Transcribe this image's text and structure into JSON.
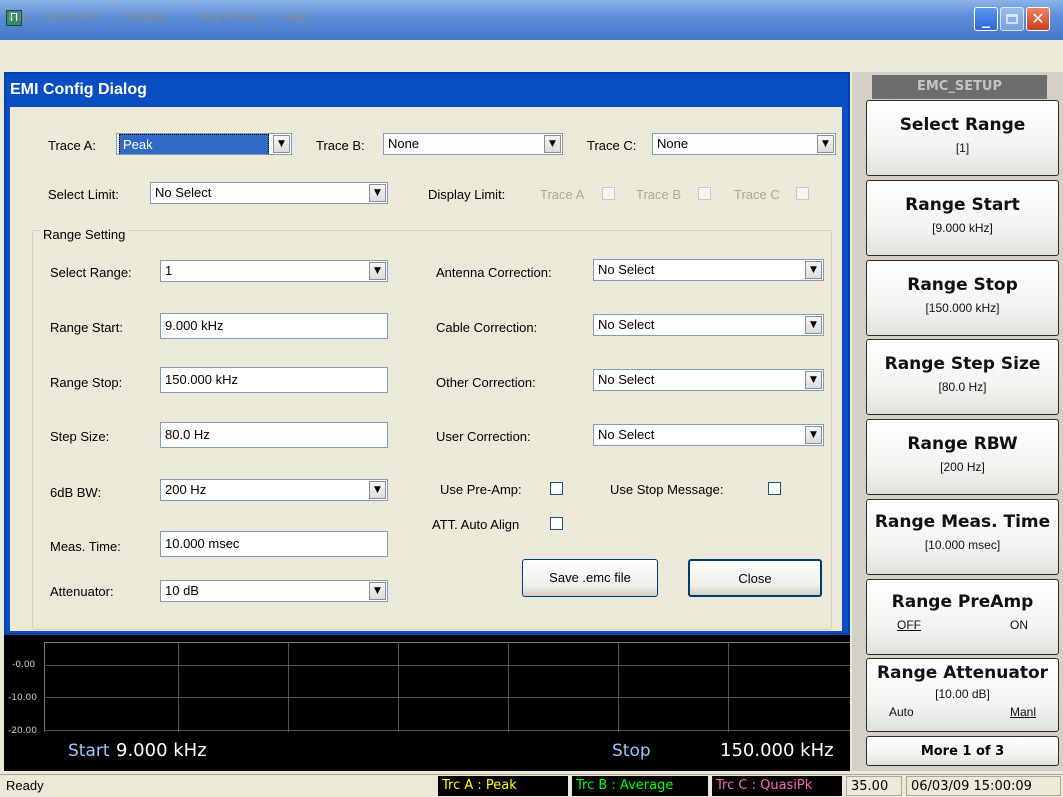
{
  "window": {
    "app_icon_glyph": "Π"
  },
  "menu": [
    "File",
    "Quick Ftn",
    "Display",
    "Key Press",
    "Help"
  ],
  "dialog": {
    "title": "EMI Config Dialog",
    "trace_a_label": "Trace A:",
    "trace_a_value": "Peak",
    "trace_b_label": "Trace B:",
    "trace_b_value": "None",
    "trace_c_label": "Trace C:",
    "trace_c_value": "None",
    "select_limit_label": "Select Limit:",
    "select_limit_value": "No Select",
    "display_limit_label": "Display Limit:",
    "display_limit_trace_a": "Trace A",
    "display_limit_trace_b": "Trace B",
    "display_limit_trace_c": "Trace C",
    "range_setting_label": "Range Setting",
    "select_range_label": "Select Range:",
    "select_range_value": "1",
    "range_start_label": "Range Start:",
    "range_start_value": "9.000 kHz",
    "range_stop_label": "Range Stop:",
    "range_stop_value": "150.000 kHz",
    "step_size_label": "Step Size:",
    "step_size_value": "80.0 Hz",
    "bw_label": "6dB BW:",
    "bw_value": "200 Hz",
    "meas_time_label": "Meas. Time:",
    "meas_time_value": "10.000 msec",
    "attenuator_label": "Attenuator:",
    "attenuator_value": "10 dB",
    "antenna_label": "Antenna Correction:",
    "antenna_value": "No Select",
    "cable_label": "Cable Correction:",
    "cable_value": "No Select",
    "other_label": "Other Correction:",
    "other_value": "No Select",
    "user_label": "User Correction:",
    "user_value": "No Select",
    "preamp_label": "Use Pre-Amp:",
    "stop_msg_label": "Use Stop Message:",
    "att_auto_label": "ATT. Auto Align",
    "save_button": "Save .emc file",
    "close_button": "Close"
  },
  "graph": {
    "y_labels": [
      "-0.00",
      "-10.00",
      "-20.00"
    ],
    "start_key": "Start",
    "start_value": "9.000 kHz",
    "stop_key": "Stop",
    "stop_value": "150.000 kHz"
  },
  "softkeys": {
    "panel_title": "EMC_SETUP",
    "select_range_title": "Select Range",
    "select_range_sub": "[1]",
    "range_start_title": "Range Start",
    "range_start_sub": "[9.000 kHz]",
    "range_stop_title": "Range Stop",
    "range_stop_sub": "[150.000 kHz]",
    "step_size_title": "Range Step Size",
    "step_size_sub": "[80.0 Hz]",
    "rbw_title": "Range RBW",
    "rbw_sub": "[200 Hz]",
    "meas_time_title": "Range Meas. Time",
    "meas_time_sub": "[10.000 msec]",
    "preamp_title": "Range PreAmp",
    "preamp_off": "OFF",
    "preamp_on": "ON",
    "atten_title": "Range Attenuator",
    "atten_sub": "[10.00 dB]",
    "atten_auto": "Auto",
    "atten_manl": "Manl",
    "more": "More 1 of 3"
  },
  "status": {
    "ready": "Ready",
    "trc_a": "Trc A : Peak",
    "trc_b": "Trc B : Average",
    "trc_c": "Trc C : QuasiPk",
    "value": "35.00",
    "datetime": "06/03/09 15:00:09"
  },
  "colors": {
    "dialog_title_bar": "#0a4ec4",
    "trc_a": "#ffff00",
    "trc_b": "#00ff00",
    "trc_c": "#ff69b4"
  }
}
